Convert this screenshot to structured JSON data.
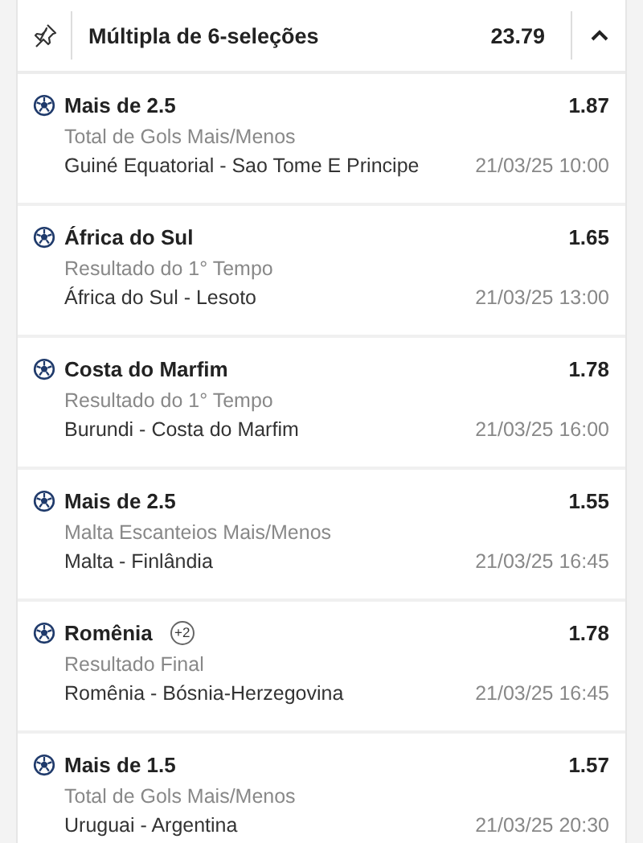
{
  "header": {
    "title": "Múltipla de 6-seleções",
    "odds": "23.79",
    "expanded": true
  },
  "selections": [
    {
      "pick": "Mais de 2.5",
      "odds": "1.87",
      "market": "Total de Gols Mais/Menos",
      "match": "Guiné Equatorial - Sao Tome E Principe",
      "datetime": "21/03/25 10:00"
    },
    {
      "pick": "África do Sul",
      "odds": "1.65",
      "market": "Resultado do 1° Tempo",
      "match": "África do Sul - Lesoto",
      "datetime": "21/03/25 13:00"
    },
    {
      "pick": "Costa do Marfim",
      "odds": "1.78",
      "market": "Resultado do 1° Tempo",
      "match": "Burundi - Costa do Marfim",
      "datetime": "21/03/25 16:00"
    },
    {
      "pick": "Mais de 2.5",
      "odds": "1.55",
      "market": "Malta Escanteios Mais/Menos",
      "match": "Malta - Finlândia",
      "datetime": "21/03/25 16:45"
    },
    {
      "pick": "Romênia",
      "badge": "+2",
      "odds": "1.78",
      "market": "Resultado Final",
      "match": "Romênia - Bósnia-Herzegovina",
      "datetime": "21/03/25 16:45"
    },
    {
      "pick": "Mais de 1.5",
      "odds": "1.57",
      "market": "Total de Gols Mais/Menos",
      "match": "Uruguai - Argentina",
      "datetime": "21/03/25 20:30"
    }
  ]
}
